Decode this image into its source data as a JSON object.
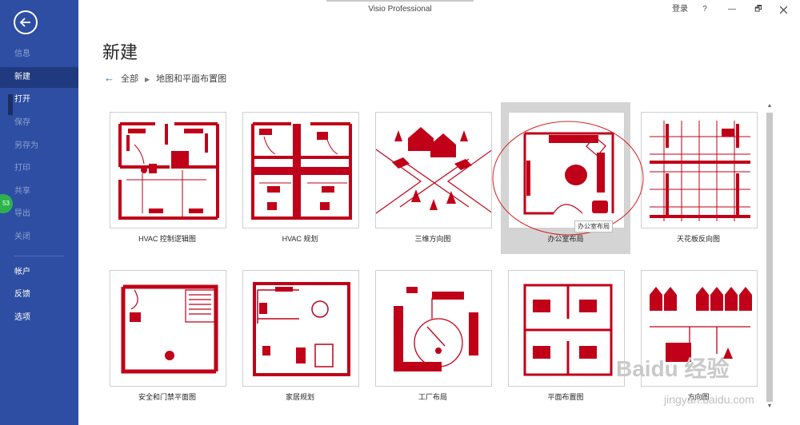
{
  "window": {
    "title": "Visio Professional",
    "sign_in": "登录",
    "help": "?",
    "restore": "🗗",
    "minimize": "—"
  },
  "sidebar": {
    "items": [
      {
        "label": "信息"
      },
      {
        "label": "新建"
      },
      {
        "label": "打开"
      },
      {
        "label": "保存"
      },
      {
        "label": "另存为"
      },
      {
        "label": "打印"
      },
      {
        "label": "共享"
      },
      {
        "label": "导出"
      },
      {
        "label": "关闭"
      },
      {
        "label": "帐户"
      },
      {
        "label": "反馈"
      },
      {
        "label": "选项"
      }
    ],
    "badge": "53"
  },
  "main": {
    "title": "新建",
    "breadcrumb": {
      "back": "←",
      "root": "全部",
      "sep": "▶",
      "current": "地图和平面布置图"
    },
    "templates": [
      {
        "label": "HVAC 控制逻辑图"
      },
      {
        "label": "HVAC 规划"
      },
      {
        "label": "三维方向图"
      },
      {
        "label": "办公室布局"
      },
      {
        "label": "天花板反向图"
      },
      {
        "label": "安全和门禁平面图"
      },
      {
        "label": "家居规划"
      },
      {
        "label": "工厂布局"
      },
      {
        "label": "平面布置图"
      },
      {
        "label": "方向图"
      }
    ],
    "tooltip": "办公室布局"
  },
  "scrollbar": {
    "up": "▲",
    "down": "▼"
  },
  "watermark": {
    "text": "Baidu 经验",
    "url": "jingyan.baidu.com"
  },
  "colors": {
    "sidebar": "#2e4ea3",
    "accent": "#c00018",
    "selected_tile": "#d4d4d4"
  }
}
